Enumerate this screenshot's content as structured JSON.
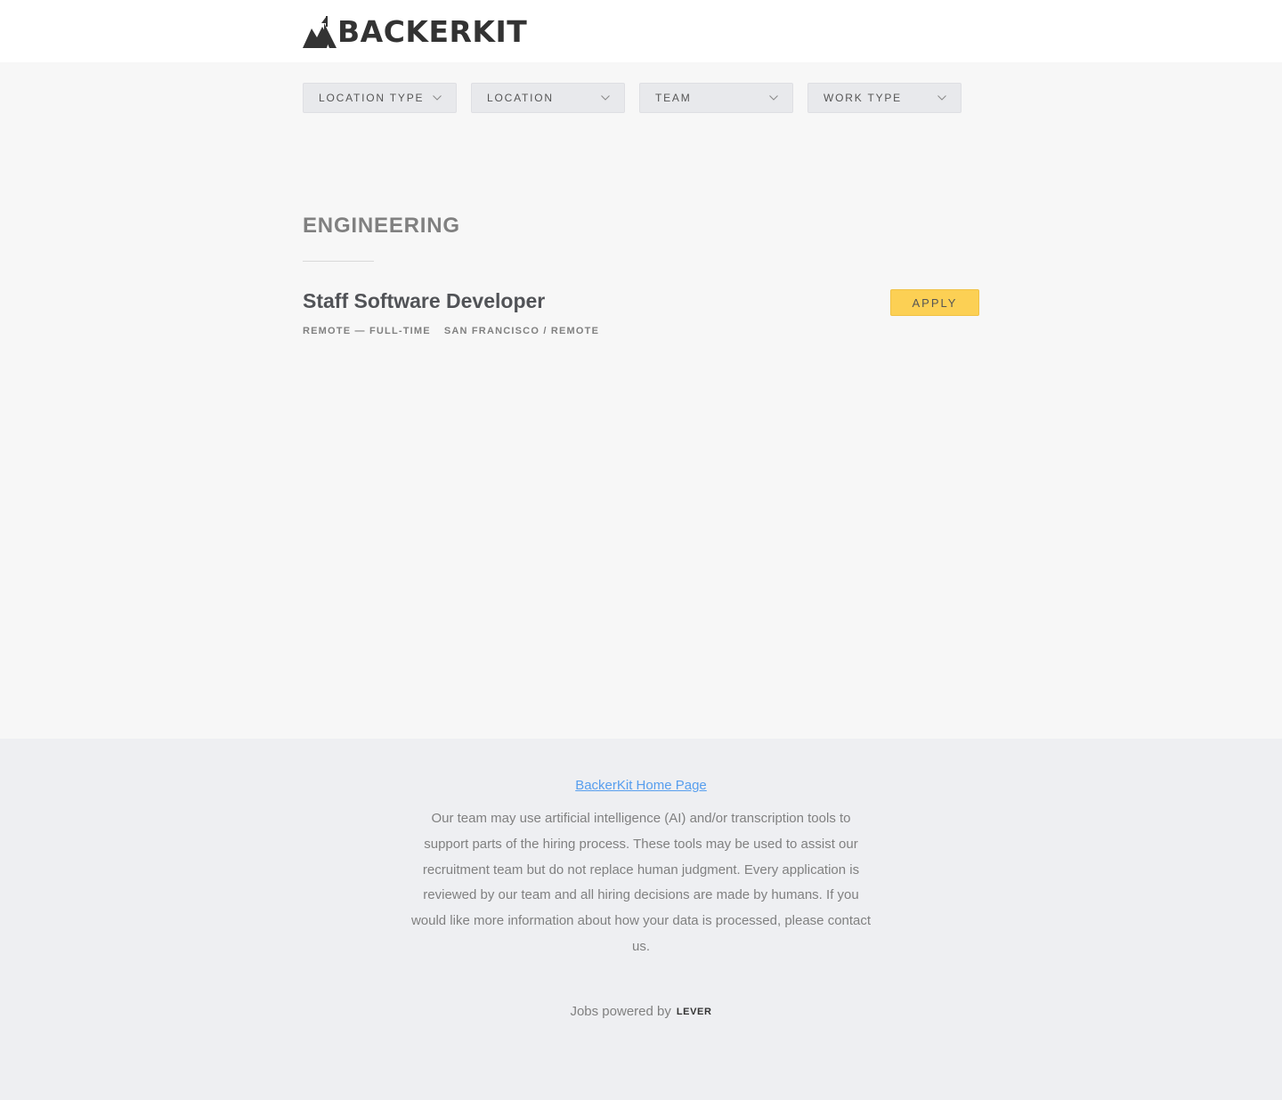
{
  "brand": {
    "name": "BACKERKIT",
    "logo_icon": "tent-mountain-logo"
  },
  "filters": [
    {
      "label": "LOCATION TYPE",
      "icon": "chevron-down-icon"
    },
    {
      "label": "LOCATION",
      "icon": "chevron-down-icon"
    },
    {
      "label": "TEAM",
      "icon": "chevron-down-icon"
    },
    {
      "label": "WORK TYPE",
      "icon": "chevron-down-icon"
    }
  ],
  "section": {
    "title": "ENGINEERING"
  },
  "postings": [
    {
      "title": "Staff Software Developer",
      "commitment": "REMOTE — FULL-TIME",
      "location": "SAN FRANCISCO / REMOTE",
      "apply_label": "APPLY"
    }
  ],
  "footer": {
    "home_link": "BackerKit Home Page",
    "disclaimer": "Our team may use artificial intelligence (AI) and/or transcription tools to support parts of the hiring process. These tools may be used to assist our recruitment team but do not replace human judgment. Every application is reviewed by our team and all hiring decisions are made by humans. If you would like more information about how your data is processed, please contact us.",
    "powered_by": "Jobs powered by",
    "powered_brand": "LEVER"
  },
  "colors": {
    "accent_apply": "#fcd054",
    "link": "#579eee",
    "page_bg": "#f7f7f7",
    "footer_bg": "#eeeff2"
  }
}
